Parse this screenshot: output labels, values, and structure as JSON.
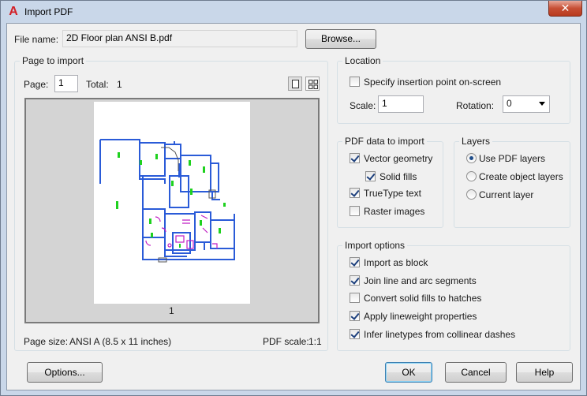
{
  "window": {
    "title": "Import PDF",
    "close_label": "✕"
  },
  "file": {
    "label": "File name:",
    "value": "2D Floor plan ANSI B.pdf",
    "browse_label": "Browse..."
  },
  "page_to_import": {
    "title": "Page to import",
    "page_label": "Page:",
    "page_value": "1",
    "total_label": "Total:",
    "total_value": "1",
    "thumbnail_caption": "1",
    "page_size_label": "Page size:",
    "page_size_value": "ANSI A (8.5 x 11 inches)",
    "pdf_scale_label": "PDF scale:",
    "pdf_scale_value": "1:1"
  },
  "location": {
    "title": "Location",
    "specify_label": "Specify insertion point on-screen",
    "specify_checked": false,
    "scale_label": "Scale:",
    "scale_value": "1",
    "rotation_label": "Rotation:",
    "rotation_value": "0"
  },
  "pdf_data": {
    "title": "PDF data to import",
    "vector_geometry": "Vector geometry",
    "solid_fills": "Solid fills",
    "truetype_text": "TrueType text",
    "raster_images": "Raster images"
  },
  "layers": {
    "title": "Layers",
    "use_pdf_layers": "Use PDF layers",
    "create_object_layers": "Create object layers",
    "current_layer": "Current layer",
    "selected": "Use PDF layers"
  },
  "import_options": {
    "title": "Import options",
    "import_as_block": "Import as block",
    "join_segments": "Join line and arc segments",
    "convert_fills": "Convert solid fills to hatches",
    "apply_lineweight": "Apply lineweight properties",
    "infer_linetypes": "Infer linetypes from collinear dashes"
  },
  "buttons": {
    "options": "Options...",
    "ok": "OK",
    "cancel": "Cancel",
    "help": "Help"
  },
  "colors": {
    "titlebar": "#c9d7e9",
    "dialog_bg": "#f0f0f0",
    "close_button": "#c74f34",
    "plan_walls": "#2a5bd8",
    "plan_fixtures": "#c01fc4",
    "plan_labels": "#1ed11e"
  }
}
